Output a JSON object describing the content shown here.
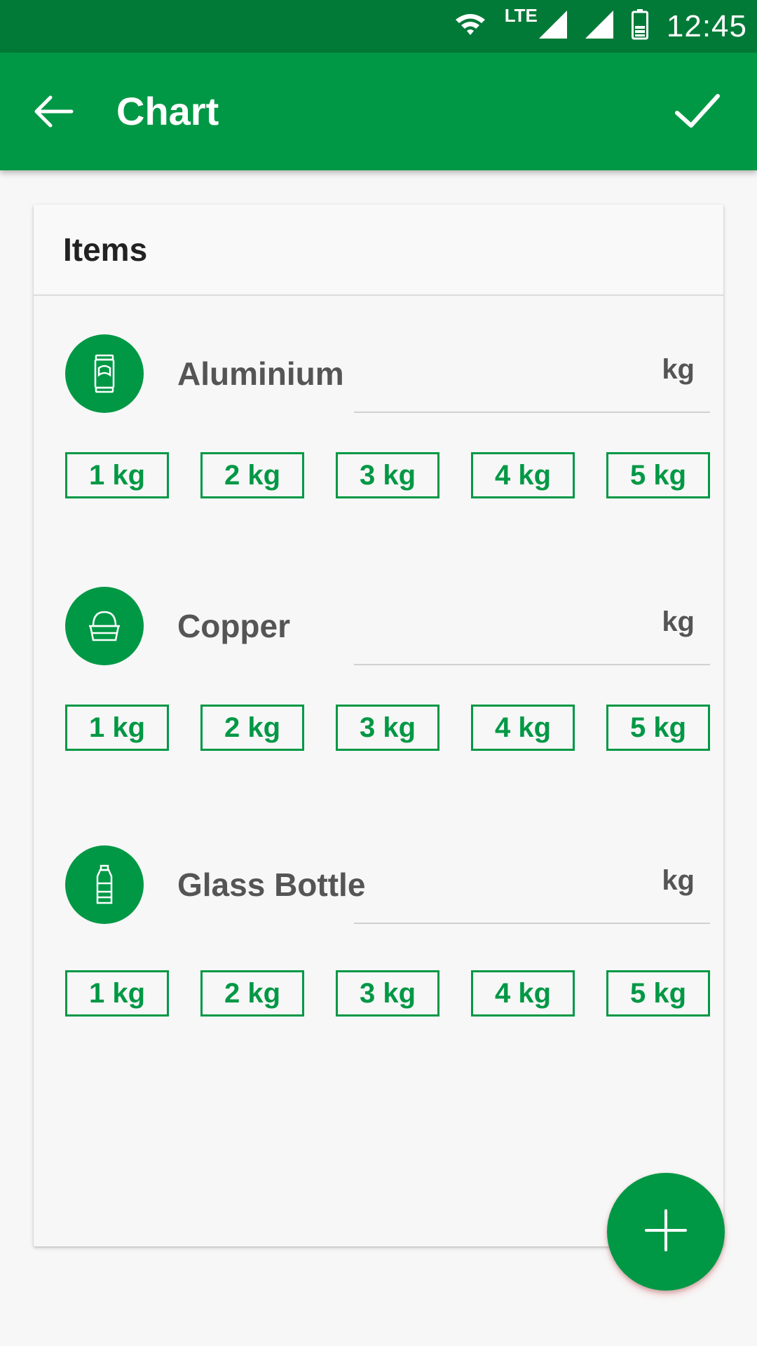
{
  "status_bar": {
    "time": "12:45",
    "network_label": "LTE",
    "icons": [
      "wifi-icon",
      "signal-icon",
      "signal-icon",
      "battery-icon"
    ]
  },
  "app_bar": {
    "title": "Chart",
    "back_icon": "arrow-left-icon",
    "confirm_icon": "check-icon"
  },
  "card": {
    "title": "Items",
    "items": [
      {
        "name": "Aluminium",
        "icon": "can-icon",
        "value": "",
        "unit": "kg",
        "quick_amounts": [
          "1 kg",
          "2 kg",
          "3 kg",
          "4 kg",
          "5 kg"
        ]
      },
      {
        "name": "Copper",
        "icon": "copper-pot-icon",
        "value": "",
        "unit": "kg",
        "quick_amounts": [
          "1 kg",
          "2 kg",
          "3 kg",
          "4 kg",
          "5 kg"
        ]
      },
      {
        "name": "Glass Bottle",
        "icon": "bottle-icon",
        "value": "",
        "unit": "kg",
        "quick_amounts": [
          "1 kg",
          "2 kg",
          "3 kg",
          "4 kg",
          "5 kg"
        ]
      }
    ]
  },
  "fab": {
    "icon": "plus-icon"
  },
  "colors": {
    "primary": "#019845",
    "primary_dark": "#017a37",
    "background": "#f7f7f7",
    "text_secondary": "#555555"
  }
}
